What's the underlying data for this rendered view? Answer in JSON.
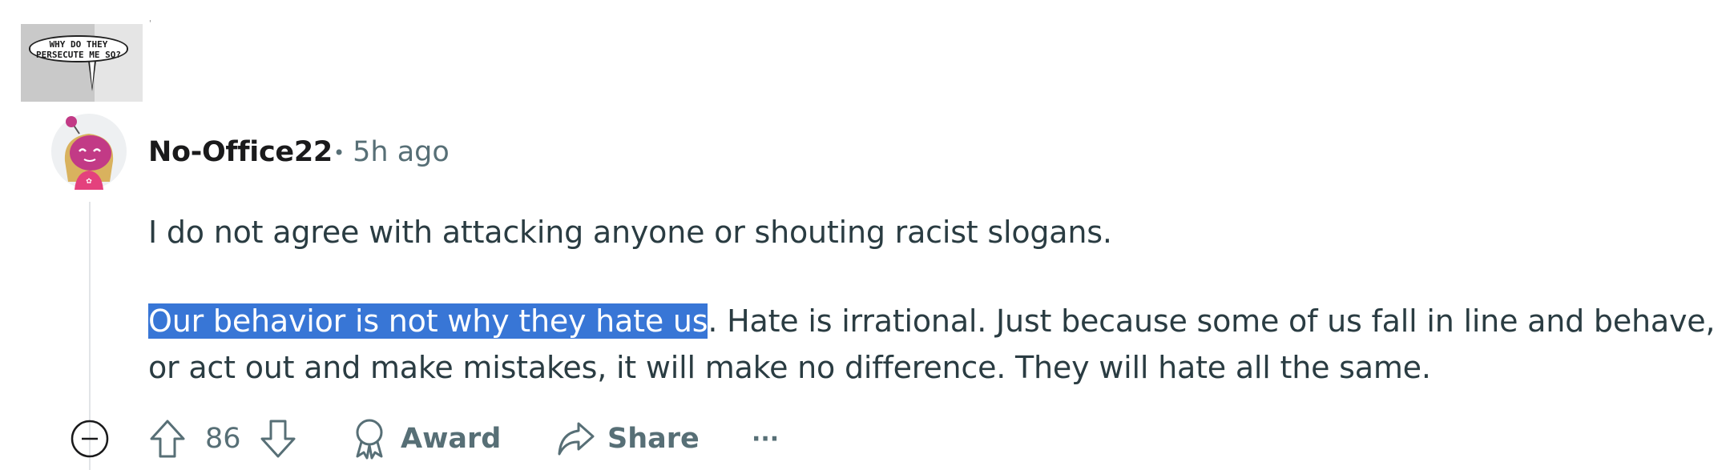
{
  "comic": {
    "bubble_line1": "WHY DO THEY",
    "bubble_line2": "PERSECUTE ME SO?"
  },
  "comment": {
    "username": "No-Office22",
    "timestamp": "5h ago",
    "paragraph1": "I do not agree with attacking anyone or shouting racist slogans.",
    "paragraph2_highlighted": "Our behavior is not why they hate us",
    "paragraph2_rest": ". Hate is irrational. Just because some of us fall in line and behave, or act out and make mistakes, it will make no difference. They will hate all the same."
  },
  "actions": {
    "vote_count": "86",
    "award_label": "Award",
    "share_label": "Share",
    "more_label": "···"
  },
  "colors": {
    "selection": "#3876d6",
    "meta_gray": "#576f76",
    "avatar_magenta": "#c23a86"
  }
}
